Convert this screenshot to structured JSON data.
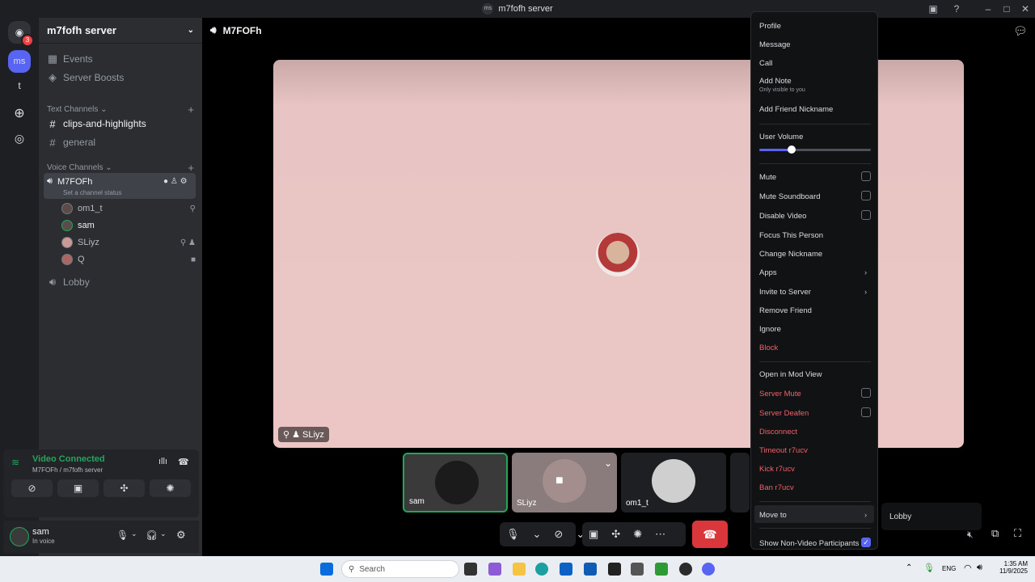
{
  "window": {
    "title": "m7fofh server",
    "icon_text": "ms"
  },
  "guilds": [
    {
      "label": "ms"
    },
    {
      "label": "t"
    }
  ],
  "guild_badges": {
    "home": "3"
  },
  "server": {
    "name": "m7fofh server"
  },
  "nav": {
    "events": "Events",
    "boosts": "Server Boosts"
  },
  "text_category": "Text Channels",
  "text_channels": [
    {
      "name": "clips-and-highlights"
    },
    {
      "name": "general"
    }
  ],
  "voice_category": "Voice Channels",
  "voice_channel": {
    "name": "M7FOFh",
    "status": "Set a channel status"
  },
  "voice_users": [
    {
      "name": "om1_t"
    },
    {
      "name": "sam"
    },
    {
      "name": "SLiyz"
    },
    {
      "name": "Q"
    }
  ],
  "lobby": "Lobby",
  "connection": {
    "status": "Video Connected",
    "channel": "M7FOFh / m7fofh server"
  },
  "user": {
    "name": "sam",
    "status": "In voice"
  },
  "stage": {
    "channel": "M7FOFh",
    "focused_user": "SLiyz"
  },
  "thumbs": [
    {
      "name": "sam"
    },
    {
      "name": "SLiyz"
    },
    {
      "name": "om1_t"
    }
  ],
  "context_menu": {
    "items": [
      "Profile",
      "Message",
      "Call",
      "Add Note"
    ],
    "note_hint": "Only visible to you",
    "friend_nickname": "Add Friend Nickname",
    "volume_label": "User Volume",
    "volume_level": 0.29,
    "toggles": [
      "Mute",
      "Mute Soundboard",
      "Disable Video"
    ],
    "actions": [
      "Focus This Person",
      "Change Nickname"
    ],
    "submenus": [
      "Apps",
      "Invite to Server"
    ],
    "friend_actions": [
      "Remove Friend",
      "Ignore"
    ],
    "block": "Block",
    "mod_view": "Open in Mod View",
    "mod_toggles": [
      "Server Mute",
      "Server Deafen"
    ],
    "mod_actions": [
      "Disconnect",
      "Timeout r7ucv",
      "Kick r7ucv",
      "Ban r7ucv"
    ],
    "move_to": "Move to",
    "show_nonvideo": "Show Non-Video Participants"
  },
  "submenu": {
    "lobby": "Lobby"
  },
  "taskbar": {
    "search": "Search",
    "lang": "ENG",
    "time": "1:35 AM",
    "date": "11/9/2025"
  },
  "colors": {
    "danger": "#da373c",
    "accent": "#5865f2",
    "connected": "#23a55a"
  }
}
